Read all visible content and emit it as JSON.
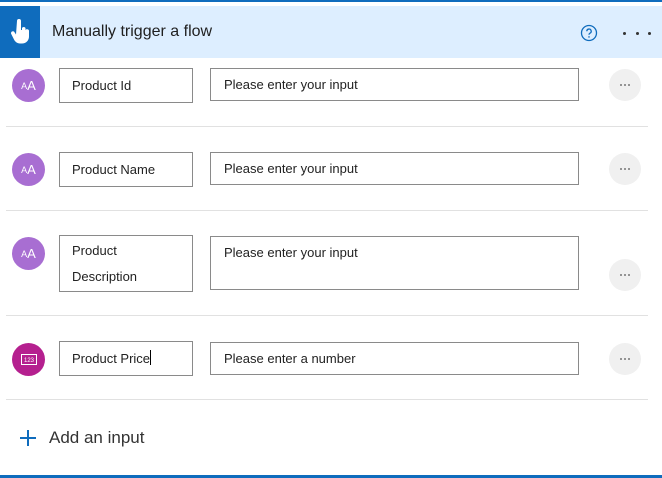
{
  "header": {
    "title": "Manually trigger a flow",
    "trigger_icon": "hand-pointer-icon",
    "help_icon": "question-circle-icon",
    "more_icon": "ellipsis-icon",
    "accent": "#0f6cbd",
    "background": "#ddeeff"
  },
  "inputs": [
    {
      "type": "text",
      "badge": "AA",
      "name": "Product Id",
      "value_placeholder": "Please enter your input"
    },
    {
      "type": "text",
      "badge": "AA",
      "name": "Product Name",
      "value_placeholder": "Please enter your input"
    },
    {
      "type": "text",
      "badge": "AA",
      "name": "Product Description",
      "value_placeholder": "Please enter your input"
    },
    {
      "type": "number",
      "badge": "123",
      "name": "Product Price",
      "value_placeholder": "Please enter a number"
    }
  ],
  "add_input": {
    "label": "Add an input"
  },
  "colors": {
    "text_badge": "#a86ed2",
    "number_badge": "#b5208f"
  }
}
